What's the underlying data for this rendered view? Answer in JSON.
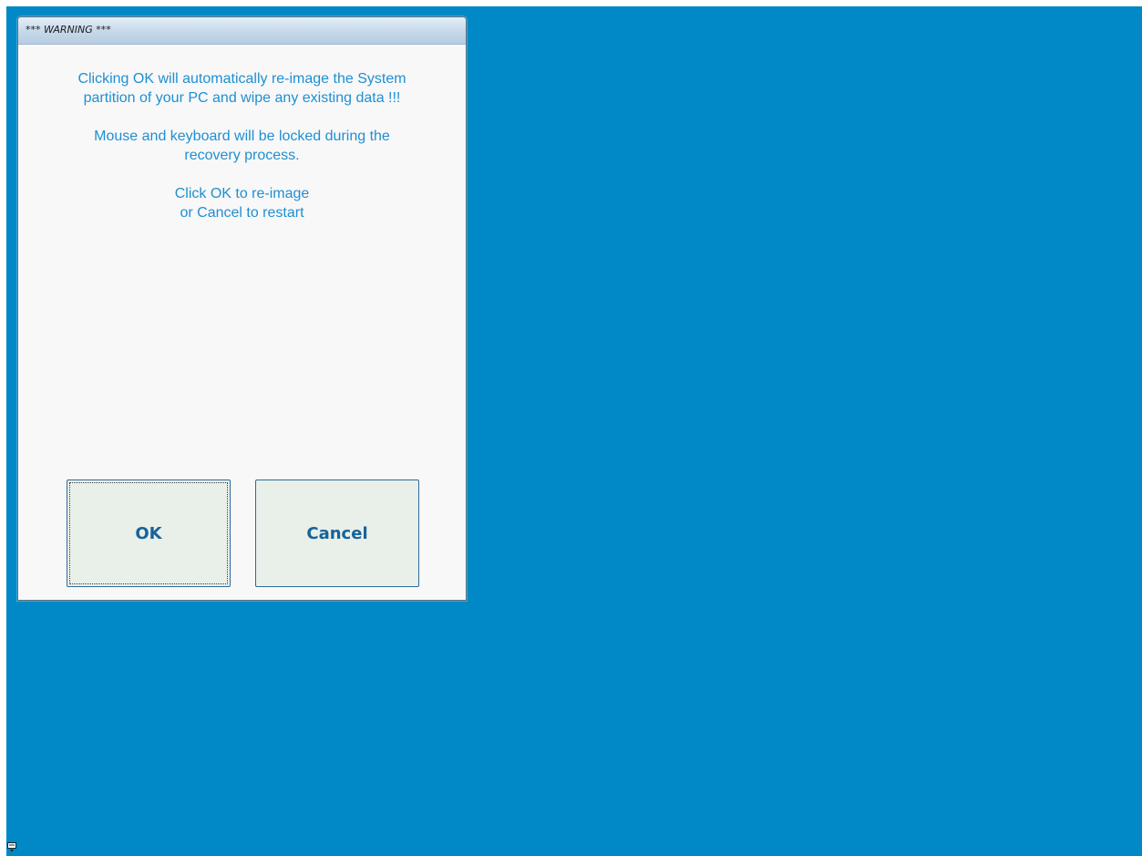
{
  "dialog": {
    "title": "*** WARNING ***",
    "message": {
      "paragraph_1_line_1": "Clicking OK will automatically re-image the System",
      "paragraph_1_line_2": "partition of your PC and wipe any existing data !!!",
      "paragraph_2_line_1": "Mouse and keyboard will be locked during the",
      "paragraph_2_line_2": "recovery process.",
      "paragraph_3_line_1": "Click OK to re-image",
      "paragraph_3_line_2": "or Cancel to restart"
    },
    "buttons": {
      "ok_label": "OK",
      "cancel_label": "Cancel"
    }
  },
  "tray": {
    "icon": "keyboard-icon"
  },
  "colors": {
    "desktop_background": "#0089c6",
    "message_text": "#1f8fd2",
    "button_text": "#17639a",
    "button_face": "#e9efe9",
    "dialog_background": "#f8f8f8"
  }
}
